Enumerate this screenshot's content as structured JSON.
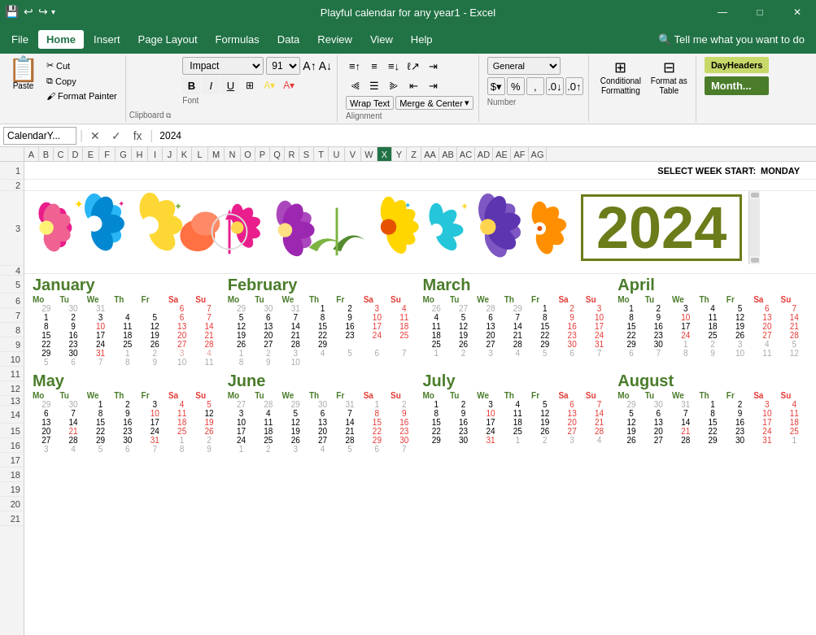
{
  "titleBar": {
    "title": "Playful calendar for any year1 - Excel"
  },
  "quickAccess": {
    "save": "💾",
    "undo": "↩",
    "redo": "↪",
    "customize": "▾"
  },
  "menuBar": {
    "items": [
      "File",
      "Home",
      "Insert",
      "Page Layout",
      "Formulas",
      "Data",
      "Review",
      "View",
      "Help"
    ]
  },
  "ribbon": {
    "clipboard": {
      "paste_label": "Paste",
      "cut_label": "✂ Cut",
      "copy_label": "Copy",
      "format_painter_label": "Format Painter",
      "group_label": "Clipboard"
    },
    "font": {
      "font_name": "Impact",
      "font_size": "91",
      "bold": "B",
      "italic": "I",
      "underline": "U",
      "group_label": "Font"
    },
    "alignment": {
      "wrap_text": "Wrap Text",
      "merge_center": "Merge & Center",
      "group_label": "Alignment"
    },
    "number": {
      "format": "General",
      "group_label": "Number"
    },
    "styles": {
      "conditional": "Conditional\nFormatting",
      "format_table": "Format as\nTable",
      "day_headers": "DayHeaders",
      "month": "Month..."
    }
  },
  "formulaBar": {
    "nameBox": "CalendarY...",
    "cancelBtn": "✕",
    "confirmBtn": "✓",
    "functionBtn": "fx",
    "formula": "2024"
  },
  "columnHeaders": [
    "A",
    "B",
    "C",
    "D",
    "E",
    "F",
    "G",
    "H",
    "I",
    "J",
    "K",
    "L",
    "M",
    "N",
    "O",
    "P",
    "Q",
    "R",
    "S",
    "T",
    "U",
    "V",
    "W",
    "X",
    "Y",
    "Z",
    "AA",
    "AB",
    "AC",
    "AD",
    "AE",
    "AF",
    "AG"
  ],
  "rowNumbers": [
    "1",
    "2",
    "3",
    "4",
    "5",
    "6",
    "7",
    "8",
    "9",
    "10",
    "11",
    "12",
    "13",
    "14",
    "15",
    "16",
    "17",
    "18",
    "19",
    "20",
    "21"
  ],
  "weekStartLabel": "SELECT WEEK START:",
  "weekStartValue": "MONDAY",
  "year": "2024",
  "months": [
    {
      "name": "January",
      "days": [
        "Mo",
        "Tu",
        "We",
        "Th",
        "Fr",
        "Sa",
        "Su"
      ],
      "weeks": [
        [
          "",
          "",
          "",
          "",
          "",
          "",
          ""
        ],
        [
          "1",
          "2",
          "3",
          "4",
          "5",
          "6",
          "7"
        ],
        [
          "8",
          "9",
          "10",
          "11",
          "12",
          "13",
          "14"
        ],
        [
          "15",
          "16",
          "17",
          "18",
          "19",
          "20",
          "21"
        ],
        [
          "22",
          "23",
          "24",
          "25",
          "26",
          "27",
          "28"
        ],
        [
          "29",
          "30",
          "31",
          "1",
          "2",
          "3",
          "4"
        ],
        [
          "5",
          "6",
          "7",
          "8",
          "9",
          "10",
          "11"
        ]
      ],
      "grays": [
        [
          6,
          0
        ],
        [
          6,
          1
        ],
        [
          6,
          2
        ],
        [
          6,
          3
        ],
        [
          6,
          4
        ],
        [
          6,
          5
        ],
        [
          6,
          6
        ],
        [
          0,
          3
        ],
        [
          0,
          4
        ],
        [
          0,
          5
        ],
        [
          0,
          6
        ]
      ],
      "reds_col": [
        5,
        6
      ],
      "red_dates": [
        "6",
        "7",
        "13",
        "14",
        "20",
        "21",
        "27",
        "28"
      ]
    },
    {
      "name": "February",
      "days": [
        "Mo",
        "Tu",
        "We",
        "Th",
        "Fr",
        "Sa",
        "Su"
      ],
      "weeks": [
        [
          "29",
          "30",
          "31",
          "1",
          "2",
          "3",
          "4"
        ],
        [
          "5",
          "6",
          "7",
          "8",
          "9",
          "10",
          "11"
        ],
        [
          "12",
          "13",
          "14",
          "15",
          "16",
          "17",
          "18"
        ],
        [
          "19",
          "20",
          "21",
          "22",
          "23",
          "24",
          "25"
        ],
        [
          "26",
          "27",
          "28",
          "29",
          "",
          "",
          ""
        ],
        [
          "1",
          "2",
          "3",
          "4",
          "5",
          "6",
          "7"
        ],
        [
          "8",
          "9",
          "10",
          "",
          "",
          "",
          ""
        ]
      ]
    },
    {
      "name": "March",
      "days": [
        "Mo",
        "Tu",
        "We",
        "Th",
        "Fr",
        "Sa",
        "Su"
      ],
      "weeks": [
        [
          "26",
          "27",
          "28",
          "29",
          "1",
          "2",
          "3"
        ],
        [
          "4",
          "5",
          "6",
          "7",
          "8",
          "9",
          "10"
        ],
        [
          "11",
          "12",
          "13",
          "14",
          "15",
          "16",
          "17"
        ],
        [
          "18",
          "19",
          "20",
          "21",
          "22",
          "23",
          "24"
        ],
        [
          "25",
          "26",
          "27",
          "28",
          "29",
          "30",
          "31"
        ],
        [
          "1",
          "2",
          "3",
          "4",
          "5",
          "6",
          "7"
        ],
        [
          "",
          "",
          "",
          "",
          "",
          "",
          ""
        ]
      ]
    },
    {
      "name": "April",
      "days": [
        "Mo",
        "Tu",
        "We",
        "Th",
        "Fr",
        "Sa",
        "Su"
      ],
      "weeks": [
        [
          "1",
          "2",
          "3",
          "4",
          "5",
          "6",
          "7"
        ],
        [
          "8",
          "9",
          "10",
          "11",
          "12",
          "13",
          "14"
        ],
        [
          "15",
          "16",
          "17",
          "18",
          "19",
          "20",
          "21"
        ],
        [
          "22",
          "23",
          "24",
          "25",
          "26",
          "27",
          "28"
        ],
        [
          "29",
          "30",
          "1",
          "2",
          "3",
          "4",
          "5"
        ],
        [
          "6",
          "7",
          "8",
          "9",
          "10",
          "11",
          "12"
        ],
        [
          "",
          "",
          "",
          "",
          "",
          "",
          ""
        ]
      ]
    },
    {
      "name": "May",
      "days": [
        "Mo",
        "Tu",
        "We",
        "Th",
        "Fr",
        "Sa",
        "Su"
      ],
      "weeks": [
        [
          "29",
          "30",
          "1",
          "2",
          "3",
          "4",
          "5"
        ],
        [
          "6",
          "7",
          "8",
          "9",
          "10",
          "11",
          "12"
        ],
        [
          "13",
          "14",
          "15",
          "16",
          "17",
          "18",
          "19"
        ],
        [
          "20",
          "21",
          "22",
          "23",
          "24",
          "25",
          "26"
        ],
        [
          "27",
          "28",
          "29",
          "30",
          "31",
          "1",
          "2"
        ],
        [
          "3",
          "4",
          "5",
          "6",
          "7",
          "8",
          "9"
        ],
        [
          "",
          "",
          "",
          "",
          "",
          "",
          ""
        ]
      ]
    },
    {
      "name": "June",
      "days": [
        "Mo",
        "Tu",
        "We",
        "Th",
        "Fr",
        "Sa",
        "Su"
      ],
      "weeks": [
        [
          "27",
          "28",
          "29",
          "30",
          "31",
          "1",
          "2"
        ],
        [
          "3",
          "4",
          "5",
          "6",
          "7",
          "8",
          "9"
        ],
        [
          "10",
          "11",
          "12",
          "13",
          "14",
          "15",
          "16"
        ],
        [
          "17",
          "18",
          "19",
          "20",
          "21",
          "22",
          "23"
        ],
        [
          "24",
          "25",
          "26",
          "27",
          "28",
          "29",
          "30"
        ],
        [
          "1",
          "2",
          "3",
          "4",
          "5",
          "6",
          "7"
        ],
        [
          "",
          "",
          "",
          "",
          "",
          "",
          ""
        ]
      ]
    },
    {
      "name": "July",
      "days": [
        "Mo",
        "Tu",
        "We",
        "Th",
        "Fr",
        "Sa",
        "Su"
      ],
      "weeks": [
        [
          "1",
          "2",
          "3",
          "4",
          "5",
          "6",
          "7"
        ],
        [
          "8",
          "9",
          "10",
          "11",
          "12",
          "13",
          "14"
        ],
        [
          "15",
          "16",
          "17",
          "18",
          "19",
          "20",
          "21"
        ],
        [
          "22",
          "23",
          "24",
          "25",
          "26",
          "27",
          "28"
        ],
        [
          "29",
          "30",
          "31",
          "1",
          "2",
          "3",
          "4"
        ],
        [
          "",
          "",
          "",
          "",
          "",
          "",
          ""
        ]
      ]
    },
    {
      "name": "August",
      "days": [
        "Mo",
        "Tu",
        "We",
        "Th",
        "Fr",
        "Sa",
        "Su"
      ],
      "weeks": [
        [
          "29",
          "30",
          "31",
          "1",
          "2",
          "3",
          "4"
        ],
        [
          "5",
          "6",
          "7",
          "8",
          "9",
          "10",
          "11"
        ],
        [
          "12",
          "13",
          "14",
          "15",
          "16",
          "17",
          "18"
        ],
        [
          "19",
          "20",
          "21",
          "22",
          "23",
          "24",
          "25"
        ],
        [
          "26",
          "27",
          "28",
          "29",
          "30",
          "31",
          "1"
        ],
        [
          "",
          "",
          "",
          "",
          "",
          "",
          ""
        ]
      ]
    }
  ]
}
